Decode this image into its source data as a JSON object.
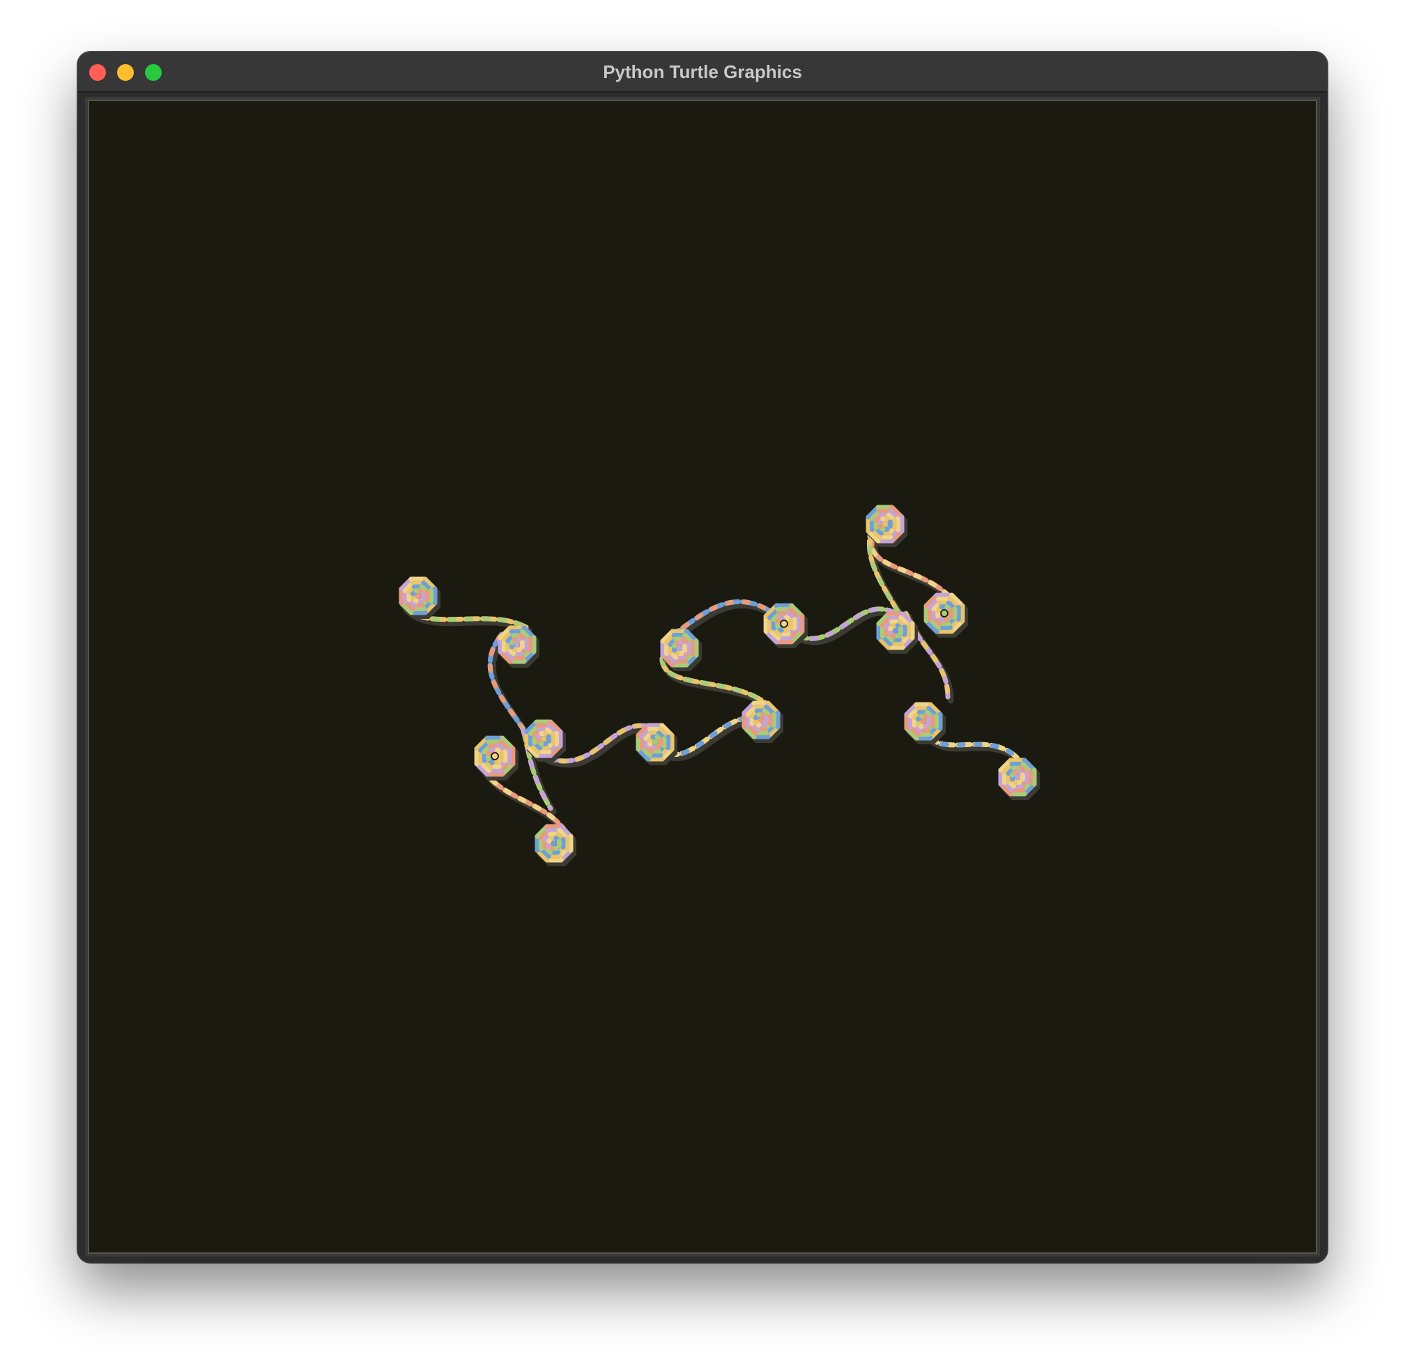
{
  "window": {
    "title": "Python Turtle Graphics"
  },
  "canvas": {
    "background_color": "#1b1a11",
    "stroke_colors": [
      "#e8c46a",
      "#6f9fd8",
      "#a8cc78",
      "#e99a7c",
      "#c6a3d6",
      "#f0d48a"
    ]
  },
  "controls": {
    "close_icon": "close-icon",
    "minimize_icon": "minimize-icon",
    "zoom_icon": "zoom-icon"
  }
}
